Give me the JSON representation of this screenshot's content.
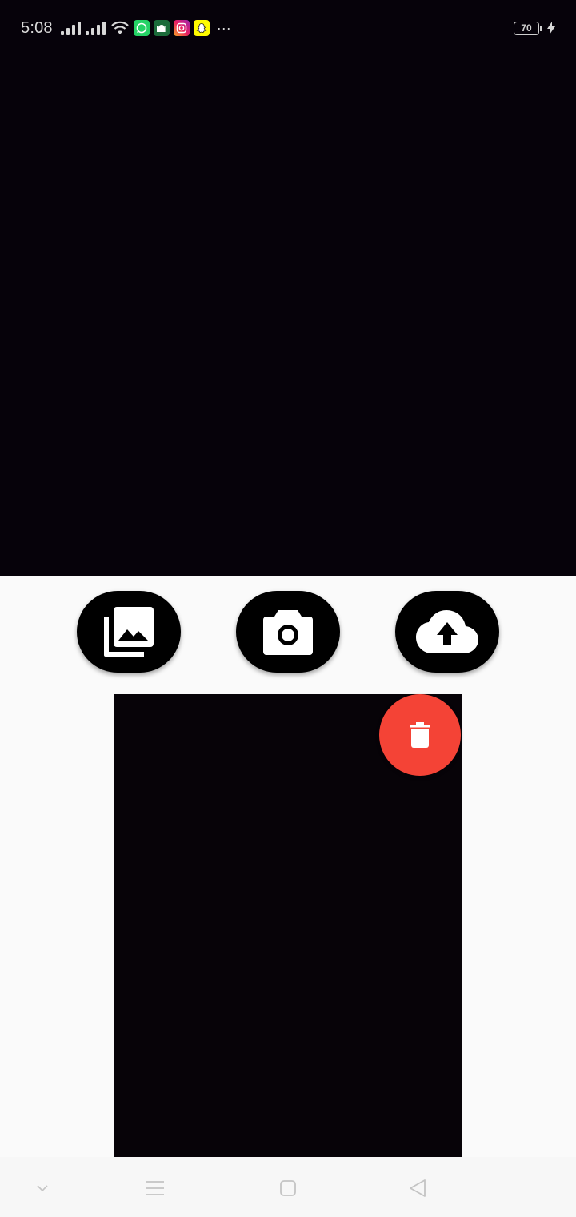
{
  "status_bar": {
    "time": "5:08",
    "battery_level": "70",
    "overflow": "···",
    "notification_apps": [
      "whatsapp-icon",
      "mosque-app-icon",
      "instagram-icon",
      "snapchat-icon"
    ]
  },
  "actions": {
    "gallery": "photo-library-icon",
    "camera": "camera-icon",
    "upload": "cloud-upload-icon"
  },
  "preview": {
    "delete": "trash-icon"
  },
  "nav_bar": {
    "items": [
      "chevron-down-icon",
      "menu-icon",
      "home-square-icon",
      "back-triangle-icon"
    ]
  },
  "colors": {
    "camera_background": "#06020a",
    "action_button": "#000000",
    "delete_button": "#f44336",
    "page_background": "#fafafa",
    "whatsapp": "#25d366",
    "snapchat": "#fffc00"
  }
}
